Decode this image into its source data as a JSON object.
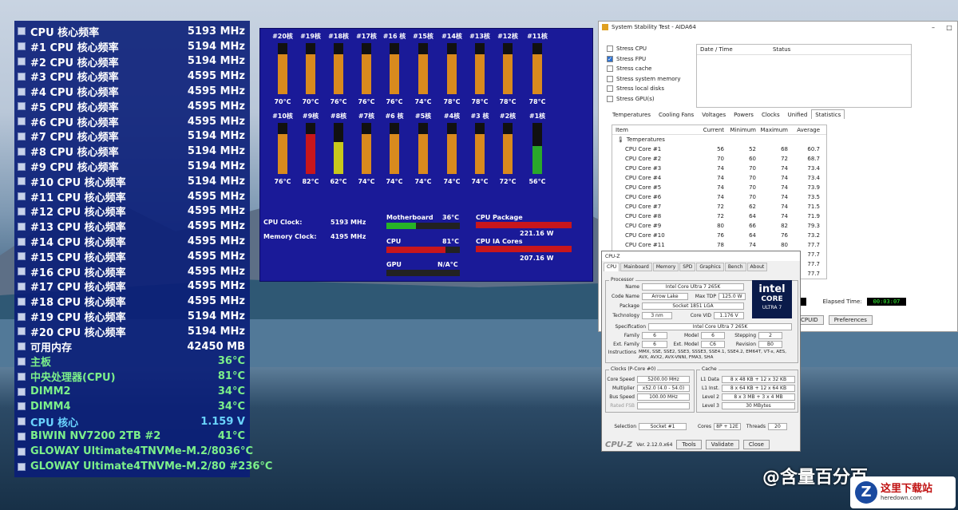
{
  "osd": {
    "rows": [
      {
        "label": "CPU 核心频率",
        "value": "5193 MHz",
        "style": "white"
      },
      {
        "label": "#1 CPU 核心频率",
        "value": "5194 MHz",
        "style": "white"
      },
      {
        "label": "#2 CPU 核心频率",
        "value": "5194 MHz",
        "style": "white"
      },
      {
        "label": "#3 CPU 核心频率",
        "value": "4595 MHz",
        "style": "white"
      },
      {
        "label": "#4 CPU 核心频率",
        "value": "4595 MHz",
        "style": "white"
      },
      {
        "label": "#5 CPU 核心频率",
        "value": "4595 MHz",
        "style": "white"
      },
      {
        "label": "#6 CPU 核心频率",
        "value": "4595 MHz",
        "style": "white"
      },
      {
        "label": "#7 CPU 核心频率",
        "value": "5194 MHz",
        "style": "white"
      },
      {
        "label": "#8 CPU 核心频率",
        "value": "5194 MHz",
        "style": "white"
      },
      {
        "label": "#9 CPU 核心频率",
        "value": "5194 MHz",
        "style": "white"
      },
      {
        "label": "#10 CPU 核心频率",
        "value": "5194 MHz",
        "style": "white"
      },
      {
        "label": "#11 CPU 核心频率",
        "value": "4595 MHz",
        "style": "white"
      },
      {
        "label": "#12 CPU 核心频率",
        "value": "4595 MHz",
        "style": "white"
      },
      {
        "label": "#13 CPU 核心频率",
        "value": "4595 MHz",
        "style": "white"
      },
      {
        "label": "#14 CPU 核心频率",
        "value": "4595 MHz",
        "style": "white"
      },
      {
        "label": "#15 CPU 核心频率",
        "value": "4595 MHz",
        "style": "white"
      },
      {
        "label": "#16 CPU 核心频率",
        "value": "4595 MHz",
        "style": "white"
      },
      {
        "label": "#17 CPU 核心频率",
        "value": "4595 MHz",
        "style": "white"
      },
      {
        "label": "#18 CPU 核心频率",
        "value": "4595 MHz",
        "style": "white"
      },
      {
        "label": "#19 CPU 核心频率",
        "value": "5194 MHz",
        "style": "white"
      },
      {
        "label": "#20 CPU 核心频率",
        "value": "5194 MHz",
        "style": "white"
      },
      {
        "label": "可用内存",
        "value": "42450 MB",
        "style": "white"
      },
      {
        "label": "主板",
        "value": "36°C",
        "style": "green"
      },
      {
        "label": "中央处理器(CPU)",
        "value": "81°C",
        "style": "green"
      },
      {
        "label": "DIMM2",
        "value": "34°C",
        "style": "green"
      },
      {
        "label": "DIMM4",
        "value": "34°C",
        "style": "green"
      },
      {
        "label": "CPU 核心",
        "value": "1.159 V",
        "style": "cyan"
      },
      {
        "label": "BIWIN NV7200 2TB #2",
        "value": "41°C",
        "style": "green"
      },
      {
        "label": "GLOWAY Ultimate4TNVMe-M.2/80",
        "value": "36°C",
        "style": "green"
      },
      {
        "label": "GLOWAY Ultimate4TNVMe-M.2/80 #2",
        "value": "36°C",
        "style": "green"
      }
    ]
  },
  "temps_panel": {
    "row1": [
      {
        "name": "#20核",
        "temp": "70°C",
        "level": 0.78,
        "color": "#d98a1e"
      },
      {
        "name": "#19核",
        "temp": "70°C",
        "level": 0.78,
        "color": "#d98a1e"
      },
      {
        "name": "#18核",
        "temp": "76°C",
        "level": 0.78,
        "color": "#d98a1e"
      },
      {
        "name": "#17核",
        "temp": "76°C",
        "level": 0.78,
        "color": "#d98a1e"
      },
      {
        "name": "#16 核",
        "temp": "76°C",
        "level": 0.78,
        "color": "#d98a1e"
      },
      {
        "name": "#15核",
        "temp": "74°C",
        "level": 0.78,
        "color": "#d98a1e"
      },
      {
        "name": "#14核",
        "temp": "78°C",
        "level": 0.78,
        "color": "#d98a1e"
      },
      {
        "name": "#13核",
        "temp": "78°C",
        "level": 0.78,
        "color": "#d98a1e"
      },
      {
        "name": "#12核",
        "temp": "78°C",
        "level": 0.78,
        "color": "#d98a1e"
      },
      {
        "name": "#11核",
        "temp": "78°C",
        "level": 0.78,
        "color": "#d98a1e"
      }
    ],
    "row2": [
      {
        "name": "#10核",
        "temp": "76°C",
        "level": 0.78,
        "color": "#d98a1e"
      },
      {
        "name": "#9核",
        "temp": "82°C",
        "level": 0.78,
        "color": "#c8161c"
      },
      {
        "name": "#8核",
        "temp": "62°C",
        "level": 0.62,
        "color": "#c8c81c"
      },
      {
        "name": "#7核",
        "temp": "74°C",
        "level": 0.78,
        "color": "#d98a1e"
      },
      {
        "name": "#6 核",
        "temp": "74°C",
        "level": 0.78,
        "color": "#d98a1e"
      },
      {
        "name": "#5核",
        "temp": "74°C",
        "level": 0.78,
        "color": "#d98a1e"
      },
      {
        "name": "#4核",
        "temp": "74°C",
        "level": 0.78,
        "color": "#d98a1e"
      },
      {
        "name": "#3 核",
        "temp": "74°C",
        "level": 0.78,
        "color": "#d98a1e"
      },
      {
        "name": "#2核",
        "temp": "72°C",
        "level": 0.78,
        "color": "#d98a1e"
      },
      {
        "name": "#1核",
        "temp": "56°C",
        "level": 0.55,
        "color": "#2aa82a"
      }
    ],
    "cpu_clock_label": "CPU Clock:",
    "cpu_clock_value": "5193 MHz",
    "mem_clock_label": "Memory Clock:",
    "mem_clock_value": "4195 MHz",
    "mb_label": "Motherboard",
    "mb_value": "36°C",
    "mb_level": 0.4,
    "cpu_label": "CPU",
    "cpu_value": "81°C",
    "cpu_level": 0.8,
    "gpu_label": "GPU",
    "gpu_value": "N/A°C",
    "pkg_label": "CPU Package",
    "pkg_value": "221.16 W",
    "ia_label": "CPU IA Cores",
    "ia_value": "207.16 W"
  },
  "aida": {
    "title": "System Stability Test - AIDA64",
    "checks": [
      {
        "label": "Stress CPU",
        "on": false
      },
      {
        "label": "Stress FPU",
        "on": true
      },
      {
        "label": "Stress cache",
        "on": false
      },
      {
        "label": "Stress system memory",
        "on": false
      },
      {
        "label": "Stress local disks",
        "on": false
      },
      {
        "label": "Stress GPU(s)",
        "on": false
      }
    ],
    "log_col1": "Date / Time",
    "log_col2": "Status",
    "tabs": [
      "Temperatures",
      "Cooling Fans",
      "Voltages",
      "Powers",
      "Clocks",
      "Unified",
      "Statistics"
    ],
    "stat_headers": [
      "Item",
      "Current",
      "Minimum",
      "Maximum",
      "Average"
    ],
    "group": "Temperatures",
    "rows": [
      [
        "CPU Core #1",
        "56",
        "52",
        "68",
        "60.7"
      ],
      [
        "CPU Core #2",
        "70",
        "60",
        "72",
        "68.7"
      ],
      [
        "CPU Core #3",
        "74",
        "70",
        "74",
        "73.4"
      ],
      [
        "CPU Core #4",
        "74",
        "70",
        "74",
        "73.4"
      ],
      [
        "CPU Core #5",
        "74",
        "70",
        "74",
        "73.9"
      ],
      [
        "CPU Core #6",
        "74",
        "70",
        "74",
        "73.5"
      ],
      [
        "CPU Core #7",
        "72",
        "62",
        "74",
        "71.5"
      ],
      [
        "CPU Core #8",
        "72",
        "64",
        "74",
        "71.9"
      ],
      [
        "CPU Core #9",
        "80",
        "66",
        "82",
        "79.3"
      ],
      [
        "CPU Core #10",
        "76",
        "64",
        "76",
        "73.2"
      ],
      [
        "CPU Core #11",
        "78",
        "74",
        "80",
        "77.7"
      ],
      [
        "",
        "",
        "",
        "",
        "77.7"
      ],
      [
        "",
        "",
        "",
        "",
        "77.7"
      ],
      [
        "",
        "",
        "",
        "",
        "77.7"
      ]
    ],
    "elapsed_label": "Elapsed Time:",
    "elapsed_value": "00:03:07",
    "elapsed_partial": "59",
    "cpuid_btn": "CPUID",
    "pref_btn": "Preferences"
  },
  "cpuz": {
    "title": "CPU-Z",
    "tabs": [
      "CPU",
      "Mainboard",
      "Memory",
      "SPD",
      "Graphics",
      "Bench",
      "About"
    ],
    "processor_title": "Processor",
    "name_k": "Name",
    "name_v": "Intel Core Ultra 7 265K",
    "code_k": "Code Name",
    "code_v": "Arrow Lake",
    "tdp_k": "Max TDP",
    "tdp_v": "125.0 W",
    "pkg_k": "Package",
    "pkg_v": "Socket 1851 LGA",
    "tech_k": "Technology",
    "tech_v": "3 nm",
    "vid_k": "Core VID",
    "vid_v": "1.176 V",
    "spec_k": "Specification",
    "spec_v": "Intel Core Ultra 7 265K",
    "fam_k": "Family",
    "fam_v": "6",
    "mod_k": "Model",
    "mod_v": "6",
    "step_k": "Stepping",
    "step_v": "2",
    "efam_k": "Ext. Family",
    "efam_v": "6",
    "emod_k": "Ext. Model",
    "emod_v": "C6",
    "rev_k": "Revision",
    "rev_v": "B0",
    "inst_k": "Instructions",
    "inst_v": "MMX, SSE, SSE2, SSE3, SSSE3, SSE4.1, SSE4.2, EM64T, VT-x, AES, AVX, AVX2, AVX-VNNI, FMA3, SHA",
    "logo_l1": "intel",
    "logo_l2": "CORE",
    "logo_l3": "ULTRA 7",
    "clocks_title": "Clocks (P-Core #0)",
    "cs_k": "Core Speed",
    "cs_v": "5200.00 MHz",
    "mul_k": "Multiplier",
    "mul_v": "x52.0 (4.0 - 54.0)",
    "bus_k": "Bus Speed",
    "bus_v": "100.00 MHz",
    "fsb_k": "Rated FSB",
    "fsb_v": "",
    "cache_title": "Cache",
    "l1d_k": "L1 Data",
    "l1d_v": "8 x 48 KB + 12 x 32 KB",
    "l1i_k": "L1 Inst.",
    "l1i_v": "8 x 64 KB + 12 x 64 KB",
    "l2_k": "Level 2",
    "l2_v": "8 x 3 MB + 3 x 4 MB",
    "l3_k": "Level 3",
    "l3_v": "30 MBytes",
    "sel_k": "Selection",
    "sel_v": "Socket #1",
    "cores_k": "Cores",
    "cores_v": "8P + 12E",
    "thr_k": "Threads",
    "thr_v": "20",
    "brand": "CPU-Z",
    "ver": "Ver. 2.12.0.x64",
    "tools_btn": "Tools",
    "validate_btn": "Validate",
    "close_btn": "Close"
  },
  "watermark": "@含量百分百",
  "site_logo": {
    "cn": "这里下载站",
    "en": "heredown.com"
  }
}
